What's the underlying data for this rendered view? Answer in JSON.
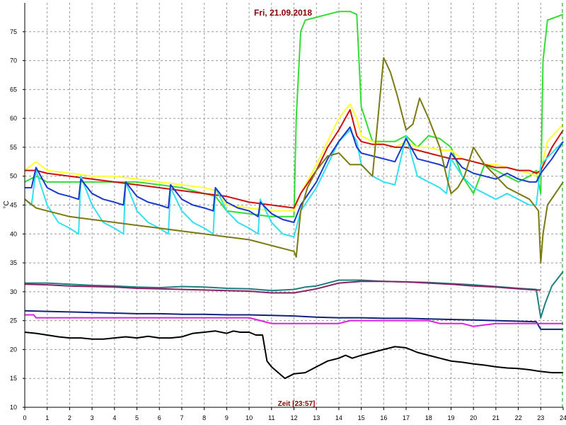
{
  "chart_data": {
    "type": "line",
    "title": "Fri, 21.09.2018",
    "xlabel": "Zeit [23:57]",
    "ylabel": "°C",
    "xlim": [
      0,
      24
    ],
    "ylim": [
      10,
      80
    ],
    "x_ticks": [
      0,
      1,
      2,
      3,
      4,
      5,
      6,
      7,
      8,
      9,
      10,
      11,
      12,
      13,
      14,
      15,
      16,
      17,
      18,
      19,
      20,
      21,
      22,
      23,
      24
    ],
    "y_ticks": [
      10,
      15,
      20,
      25,
      30,
      35,
      40,
      45,
      50,
      55,
      60,
      65,
      70,
      75
    ],
    "grid": true,
    "legend": "none",
    "colors": {
      "title": "#8b0000",
      "xlabel": "#8b0000",
      "grid": "#9a9a9a",
      "now_marker": "#00a000"
    },
    "series": [
      {
        "color": "#33dd33",
        "x": [
          0,
          0.5,
          1,
          2,
          3,
          4,
          5,
          6,
          7,
          8,
          8.5,
          9,
          10,
          11,
          11.5,
          12,
          12.1,
          12.3,
          12.5,
          13,
          13.5,
          14,
          14.5,
          14.8,
          15,
          15.5,
          16,
          16.5,
          17,
          17.5,
          18,
          18.5,
          19,
          19.5,
          20,
          20.5,
          21,
          21.5,
          22,
          22.5,
          22.8,
          23,
          23.1,
          23.3,
          24
        ],
        "y": [
          49,
          50,
          49,
          49,
          49,
          49,
          49,
          48.5,
          48,
          47,
          46.5,
          44,
          43.5,
          43,
          43,
          43,
          60,
          75,
          77,
          77.5,
          78,
          78.5,
          78.5,
          78,
          62,
          56,
          56,
          56,
          57,
          55,
          57,
          56.5,
          55,
          50,
          47,
          52,
          51,
          50,
          49,
          50,
          51,
          47,
          70,
          77,
          78
        ]
      },
      {
        "color": "#ffff33",
        "x": [
          0,
          0.5,
          1,
          2,
          3,
          4,
          5,
          6,
          7,
          8,
          8.5,
          9,
          10,
          11,
          11.5,
          12,
          12.3,
          13,
          13.5,
          14,
          14.5,
          14.8,
          15,
          15.5,
          16,
          16.5,
          17,
          17.5,
          18,
          18.5,
          19,
          19.5,
          20,
          20.5,
          21,
          21.5,
          22,
          22.5,
          22.8,
          23,
          23.3,
          24
        ],
        "y": [
          51,
          52.5,
          51,
          50.5,
          50,
          50,
          49.5,
          49,
          48.5,
          48,
          47.5,
          45,
          44.5,
          44,
          44,
          44,
          47,
          52,
          56,
          60,
          62.5,
          60,
          57,
          56,
          55.5,
          55,
          56,
          55,
          55,
          54.5,
          54.5,
          53,
          52.5,
          52,
          52,
          51.5,
          51,
          50.5,
          50,
          51,
          56,
          59
        ]
      },
      {
        "color": "#cc1111",
        "x": [
          0,
          0.5,
          1,
          2,
          3,
          4,
          5,
          6,
          7,
          8,
          9,
          10,
          11,
          12,
          12.3,
          13,
          13.5,
          14,
          14.5,
          14.8,
          15,
          15.5,
          16,
          16.5,
          17,
          17.5,
          18,
          18.5,
          19,
          19.5,
          20,
          20.5,
          21,
          21.5,
          22,
          22.5,
          22.8,
          23,
          23.5,
          24
        ],
        "y": [
          51,
          51,
          50.5,
          50,
          49.5,
          49,
          48.5,
          48,
          47.5,
          47,
          46.5,
          45.5,
          45,
          44.5,
          47,
          51,
          55,
          58,
          61.5,
          57,
          56,
          55.5,
          55.5,
          55,
          55,
          54.5,
          54,
          53.5,
          53,
          53,
          52.5,
          52,
          51.5,
          51.5,
          51,
          51,
          50.5,
          51,
          55,
          58
        ]
      },
      {
        "color": "#33e0f0",
        "x": [
          0,
          0.3,
          0.5,
          1,
          1.5,
          2,
          2.4,
          2.5,
          3,
          3.5,
          4,
          4.4,
          4.5,
          5,
          5.5,
          6,
          6.4,
          6.5,
          7,
          7.5,
          8,
          8.4,
          8.5,
          9,
          9.5,
          10,
          10.4,
          10.5,
          11,
          11.5,
          12,
          12.3,
          13,
          13.5,
          14,
          14.5,
          14.8,
          15,
          15.5,
          16,
          16.5,
          17,
          17.5,
          18,
          18.5,
          18.8,
          19,
          19.5,
          20,
          20.5,
          21,
          21.5,
          22,
          22.5,
          22.8,
          23,
          23.5,
          24
        ],
        "y": [
          46,
          45,
          51,
          45,
          42,
          41,
          40,
          50,
          45,
          42,
          41,
          40,
          49,
          44,
          42,
          41,
          40,
          48,
          44,
          42,
          41,
          40,
          48,
          44,
          42,
          41,
          40,
          46,
          42,
          40,
          39.5,
          44,
          48,
          52,
          56,
          58,
          56,
          52,
          50,
          49,
          48.5,
          57,
          50,
          49,
          48,
          47,
          53,
          50,
          48,
          47,
          46,
          47,
          46,
          45,
          45,
          52,
          54,
          56
        ]
      },
      {
        "color": "#1a3acc",
        "x": [
          0,
          0.3,
          0.5,
          1,
          1.5,
          2,
          2.4,
          2.5,
          3,
          3.5,
          4,
          4.4,
          4.5,
          5,
          5.5,
          6,
          6.4,
          6.5,
          7,
          7.5,
          8,
          8.4,
          8.5,
          9,
          9.5,
          10,
          10.4,
          10.5,
          11,
          11.5,
          12,
          12.3,
          13,
          13.5,
          14,
          14.5,
          14.8,
          15,
          15.5,
          16,
          16.5,
          17,
          17.5,
          18,
          18.5,
          18.8,
          19,
          19.5,
          20,
          20.5,
          21,
          21.5,
          22,
          22.5,
          22.8,
          23,
          23.5,
          24
        ],
        "y": [
          48,
          48,
          51.5,
          48,
          47,
          46.5,
          46,
          49.5,
          47,
          46,
          45.5,
          45,
          49,
          46.5,
          45.5,
          45,
          44.5,
          48.5,
          46,
          45,
          44.5,
          44,
          48,
          45.5,
          44.5,
          44,
          43,
          45.5,
          43.5,
          42.5,
          42,
          45,
          49,
          53,
          56,
          58.5,
          55,
          54,
          53.5,
          53,
          52.5,
          56.5,
          53,
          52.5,
          52,
          51.5,
          54,
          51.5,
          50.5,
          50,
          49.5,
          50.5,
          49.5,
          49,
          49,
          50.5,
          53,
          56
        ]
      },
      {
        "color": "#7a7a11",
        "x": [
          0,
          0.5,
          1,
          2,
          3,
          4,
          5,
          6,
          7,
          8,
          9,
          10,
          11,
          11.5,
          12,
          12.1,
          12.3,
          12.6,
          13,
          13.5,
          14,
          14.5,
          15,
          15.5,
          16,
          16.3,
          16.6,
          17,
          17.3,
          17.6,
          18,
          18.5,
          18.8,
          19,
          19.3,
          19.6,
          20,
          20.5,
          21,
          21.5,
          22,
          22.5,
          22.9,
          23,
          23.1,
          23.3,
          24
        ],
        "y": [
          46,
          44.5,
          44,
          43,
          42.5,
          42,
          41.5,
          41,
          40.5,
          40,
          39.5,
          39,
          38,
          37.5,
          37,
          36,
          44,
          48,
          51,
          53.5,
          54,
          52,
          52,
          50,
          70.5,
          68,
          64,
          58,
          59,
          63.5,
          60,
          55,
          50,
          47,
          48,
          50,
          55,
          52,
          50,
          48,
          47,
          46,
          44,
          35,
          40,
          45,
          49
        ]
      },
      {
        "color": "#1f7f7f",
        "x": [
          0,
          1,
          2,
          3,
          4,
          5,
          6,
          7,
          8,
          9,
          10,
          11,
          12,
          12.5,
          13,
          14,
          15,
          16,
          17,
          18,
          19,
          20,
          21,
          22,
          22.8,
          23,
          23.2,
          23.5,
          24
        ],
        "y": [
          31.5,
          31.5,
          31.3,
          31.1,
          31,
          30.8,
          30.7,
          30.9,
          30.8,
          30.6,
          30.5,
          30.2,
          30.4,
          30.8,
          31,
          32,
          32,
          31.8,
          31.7,
          31.6,
          31.4,
          31.2,
          30.9,
          30.6,
          30.4,
          25.5,
          28,
          31,
          33.5
        ]
      },
      {
        "color": "#882266",
        "x": [
          0,
          1,
          2,
          3,
          4,
          5,
          6,
          7,
          8,
          9,
          10,
          11,
          12,
          13,
          14,
          15,
          16,
          17,
          18,
          19,
          20,
          21,
          22,
          22.8,
          23
        ],
        "y": [
          31.3,
          31.2,
          31,
          30.9,
          30.8,
          30.6,
          30.5,
          30.4,
          30.3,
          30.2,
          30.1,
          29.8,
          29.8,
          30.5,
          31.5,
          31.8,
          31.8,
          31.7,
          31.5,
          31.3,
          31,
          30.8,
          30.5,
          30.3,
          30.3
        ]
      },
      {
        "color": "#11227a",
        "x": [
          0,
          1,
          2,
          3,
          4,
          5,
          6,
          7,
          8,
          9,
          10,
          11,
          12,
          13,
          14,
          15,
          16,
          17,
          18,
          19,
          20,
          21,
          22,
          22.8,
          23,
          24
        ],
        "y": [
          26.7,
          26.6,
          26.5,
          26.4,
          26.3,
          26.2,
          26.2,
          26.1,
          26.1,
          26,
          26,
          25.9,
          25.8,
          25.6,
          25.5,
          25.5,
          25.4,
          25.4,
          25.3,
          25.2,
          25.1,
          25,
          24.9,
          24.8,
          23.5,
          23.5
        ]
      },
      {
        "color": "#dd22dd",
        "x": [
          0,
          0.4,
          0.5,
          1,
          2,
          3,
          4,
          5,
          6,
          7,
          8,
          9,
          10,
          10.5,
          11,
          12,
          13,
          14,
          14.5,
          15,
          16,
          17,
          18,
          18.5,
          19,
          19.5,
          20,
          21,
          22,
          22.5,
          23,
          24
        ],
        "y": [
          26,
          26,
          25.5,
          25.5,
          25.5,
          25.5,
          25.5,
          25.5,
          25.5,
          25.5,
          25.5,
          25.5,
          25.5,
          25,
          24.5,
          24.5,
          24.5,
          24.5,
          25,
          25,
          25,
          25,
          25,
          24.5,
          24.5,
          24.5,
          24,
          24.5,
          24.5,
          24.5,
          24.5,
          24.5
        ]
      },
      {
        "color": "#000000",
        "x": [
          0,
          0.5,
          1,
          1.5,
          2,
          2.5,
          3,
          3.5,
          4,
          4.5,
          5,
          5.5,
          6,
          6.5,
          7,
          7.5,
          8,
          8.5,
          9,
          9.3,
          9.6,
          10,
          10.3,
          10.6,
          10.8,
          11,
          11.3,
          11.6,
          12,
          12.5,
          13,
          13.5,
          14,
          14.3,
          14.6,
          15,
          15.5,
          16,
          16.5,
          17,
          17.5,
          18,
          18.5,
          19,
          19.5,
          20,
          20.5,
          21,
          21.5,
          22,
          22.5,
          23,
          23.5,
          24
        ],
        "y": [
          23,
          22.8,
          22.5,
          22.2,
          22,
          22,
          21.8,
          21.8,
          22,
          22.2,
          22,
          22.3,
          22,
          22,
          22.2,
          22.8,
          23,
          23.2,
          22.8,
          23.2,
          23,
          23,
          22.5,
          22.5,
          18,
          17,
          16,
          15,
          15.8,
          16,
          17,
          18,
          18.5,
          19,
          18.5,
          19,
          19.5,
          20,
          20.5,
          20.3,
          19.5,
          19,
          18.5,
          18,
          17.8,
          17.5,
          17.3,
          17,
          16.8,
          16.7,
          16.5,
          16.2,
          16,
          16
        ]
      }
    ]
  }
}
